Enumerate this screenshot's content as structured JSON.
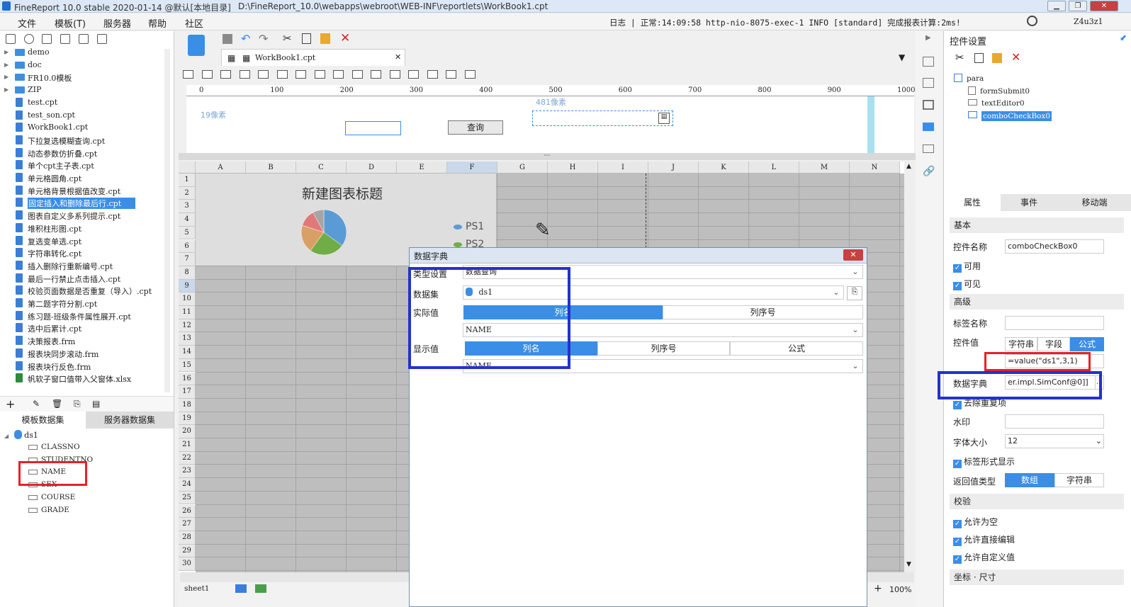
{
  "window": {
    "title": "FineReport 10.0 stable 2020-01-14 @默认[本地目录]",
    "path": "D:\\FineReport_10.0\\webapps\\webroot\\WEB-INF\\reportlets\\WorkBook1.cpt"
  },
  "menu": {
    "items": [
      "文件",
      "模板(T)",
      "服务器",
      "帮助",
      "社区"
    ],
    "log": "日志 | 正常:14:09:58 http-nio-8075-exec-1 INFO [standard] 完成报表计算:2ms!",
    "user": "Z4u3z1"
  },
  "tree": {
    "items": [
      {
        "label": "demo",
        "type": "folder"
      },
      {
        "label": "doc",
        "type": "folder"
      },
      {
        "label": "FR10.0模板",
        "type": "folder"
      },
      {
        "label": "ZIP",
        "type": "folder"
      },
      {
        "label": "test.cpt",
        "type": "cpt"
      },
      {
        "label": "test_son.cpt",
        "type": "cpt"
      },
      {
        "label": "WorkBook1.cpt",
        "type": "cpt"
      },
      {
        "label": "下拉复选模糊查询.cpt",
        "type": "cpt"
      },
      {
        "label": "动态参数仿折叠.cpt",
        "type": "cpt"
      },
      {
        "label": "单个cpt主子表.cpt",
        "type": "cpt"
      },
      {
        "label": "单元格圆角.cpt",
        "type": "cpt"
      },
      {
        "label": "单元格背景根据值改变.cpt",
        "type": "cpt"
      },
      {
        "label": "固定插入和删除最后行.cpt",
        "type": "cpt",
        "selected": true
      },
      {
        "label": "图表自定义多系列提示.cpt",
        "type": "cpt"
      },
      {
        "label": "堆积柱形图.cpt",
        "type": "cpt"
      },
      {
        "label": "复选变单选.cpt",
        "type": "cpt"
      },
      {
        "label": "字符串转化.cpt",
        "type": "cpt"
      },
      {
        "label": "插入删除行重新编号.cpt",
        "type": "cpt"
      },
      {
        "label": "最后一行禁止点击插入.cpt",
        "type": "cpt"
      },
      {
        "label": "校验页面数据是否重复（导入）.cpt",
        "type": "cpt"
      },
      {
        "label": "第二题字符分割.cpt",
        "type": "cpt"
      },
      {
        "label": "练习题-班级条件属性展开.cpt",
        "type": "cpt"
      },
      {
        "label": "选中后累计.cpt",
        "type": "cpt"
      },
      {
        "label": "决策报表.frm",
        "type": "frm"
      },
      {
        "label": "报表块同步滚动.frm",
        "type": "frm"
      },
      {
        "label": "报表块行反色.frm",
        "type": "frm"
      },
      {
        "label": "帆软子窗口值带入父窗体.xlsx",
        "type": "xlsx"
      }
    ]
  },
  "datasets": {
    "tabs": [
      "模板数据集",
      "服务器数据集"
    ],
    "root": "ds1",
    "fields": [
      "CLASSNO",
      "STUDENTNO",
      "NAME",
      "SEX",
      "COURSE",
      "GRADE"
    ]
  },
  "editor": {
    "tab": "WorkBook1.cpt",
    "ruler": [
      "0",
      "100",
      "200",
      "300",
      "400",
      "500",
      "600",
      "700",
      "800",
      "900",
      "1000"
    ],
    "param_left_hint": "19像素",
    "param_top_hint": "481像素",
    "query_button": "查询",
    "columns": [
      "A",
      "B",
      "C",
      "D",
      "E",
      "F",
      "G",
      "H",
      "I",
      "J",
      "K",
      "L",
      "M",
      "N"
    ],
    "rows": [
      "1",
      "2",
      "3",
      "4",
      "5",
      "6",
      "7",
      "8",
      "9",
      "10",
      "11",
      "12",
      "13",
      "14",
      "15",
      "16",
      "17",
      "18",
      "19",
      "20",
      "21",
      "22",
      "23",
      "24",
      "25",
      "26",
      "27",
      "28",
      "29",
      "30"
    ],
    "sheet_tab": "sheet1",
    "zoom": "100%"
  },
  "chart_data": {
    "type": "pie",
    "title": "新建图表标题",
    "legend": [
      "PS1",
      "PS2"
    ],
    "legend_placement": "right",
    "values": [
      35,
      25,
      20,
      12,
      8
    ],
    "colors": [
      "#5b9bd5",
      "#70ad47",
      "#d9a066",
      "#e0787a",
      "#a5a5a5"
    ]
  },
  "dialog": {
    "title": "数据字典",
    "type_label": "类型设置",
    "type_value": "数据查询",
    "dataset_label": "数据集",
    "dataset_value": "ds1",
    "actual_label": "实际值",
    "actual_tabs": [
      "列名",
      "列序号"
    ],
    "actual_value": "NAME",
    "display_label": "显示值",
    "display_tabs": [
      "列名",
      "列序号",
      "公式"
    ],
    "display_value": "NAME"
  },
  "right": {
    "header": "控件设置",
    "tree": [
      "para",
      "formSubmit0",
      "textEditor0",
      "comboCheckBox0"
    ],
    "tabs": [
      "属性",
      "事件",
      "移动端"
    ],
    "sec_basic": "基本",
    "name_label": "控件名称",
    "name_value": "comboCheckBox0",
    "enabled": "可用",
    "visible": "可见",
    "sec_adv": "高级",
    "tag_label": "标签名称",
    "value_label": "控件值",
    "value_tabs": [
      "字符串",
      "字段",
      "公式"
    ],
    "formula": "=value(\"ds1\",3,1)",
    "dict_label": "数据字典",
    "dict_value": "er.impl.SimConf@0]]",
    "dedupe": "去除重复项",
    "watermark": "水印",
    "fontsize_label": "字体大小",
    "fontsize_value": "12",
    "tag_display": "标签形式显示",
    "return_label": "返回值类型",
    "return_tabs": [
      "数组",
      "字符串"
    ],
    "sec_check": "校验",
    "allow_empty": "允许为空",
    "allow_edit": "允许直接编辑",
    "allow_custom": "允许自定义值",
    "sec_pos": "坐标 · 尺寸"
  },
  "colors": {
    "accent": "#3a8ee6",
    "red_box": "#e8202a",
    "blue_box": "#2233cc"
  }
}
